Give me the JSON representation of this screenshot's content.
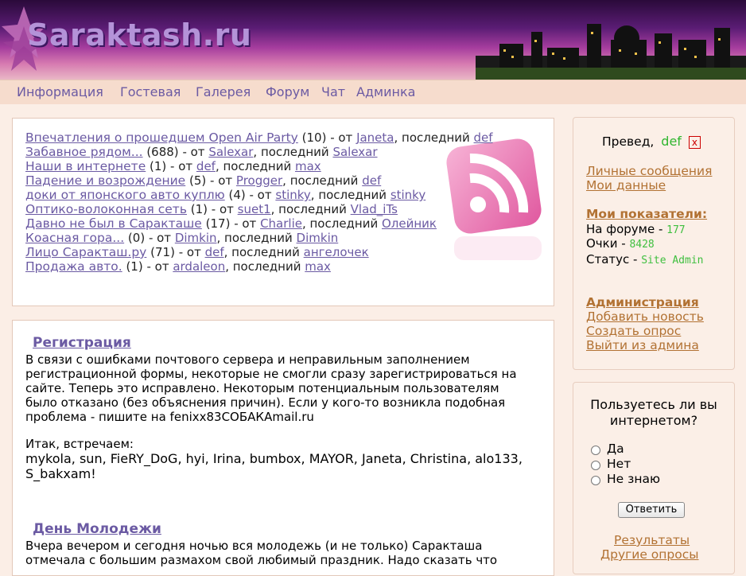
{
  "site": {
    "title": "Saraktash.ru"
  },
  "nav": [
    "Информация",
    "Гостевая",
    "Галерея",
    "Форум",
    "Чат",
    "Админка"
  ],
  "topics": [
    {
      "title": "Впечатления о прошедшем Open Air Party",
      "count": "(10)",
      "author": "Janeta",
      "last": "def"
    },
    {
      "title": "Забавное рядом...",
      "count": "(688)",
      "author": "Salexar",
      "last": "Salexar"
    },
    {
      "title": "Наши в интернете",
      "count": "(1)",
      "author": "def",
      "last": "max"
    },
    {
      "title": "Падение и возрождение",
      "count": "(5)",
      "author": "Progger",
      "last": "def"
    },
    {
      "title": "доки от японского авто куплю",
      "count": "(4)",
      "author": "stinky",
      "last": "stinky"
    },
    {
      "title": "Оптико-волоконная сеть",
      "count": "(1)",
      "author": "suet1",
      "last": "Vlad_iTs"
    },
    {
      "title": "Давно не был в Саракташе",
      "count": "(17)",
      "author": "Charlie",
      "last": "Олейник"
    },
    {
      "title": "Коасная гора...",
      "count": "(0)",
      "author": "Dimkin",
      "last": "Dimkin"
    },
    {
      "title": "Лицо Саракташ.ру",
      "count": "(71)",
      "author": "def",
      "last": "ангелочек"
    },
    {
      "title": "Продажа авто.",
      "count": "(1)",
      "author": "ardaleon",
      "last": "max"
    }
  ],
  "labels": {
    "from": " - от ",
    "last": ", последний "
  },
  "news": [
    {
      "title": "Регистрация",
      "body": "В связи с ошибками почтового сервера и неправильным заполнением регистрационной формы, некоторые не смогли сразу зарегистрироваться на сайте. Теперь это исправлено. Некоторым потенциальным пользователям было отказано (без объяснения причин). Если у кого-то возникла подобная проблема - пишите на fenixx83СОБАКАmail.ru",
      "meet_label": "Итак, встречаем:",
      "names": "mykola, sun, FieRY_DoG, hyi, Irina, bumbox, MAYOR, Janeta, Christina, alo133, S_bakxam!"
    },
    {
      "title": "День Молодежи",
      "body": "Вчера вечером и сегодня ночью вся молодежь (и не только) Саракташа отмечала с большим размахом свой любимый праздник. Надо сказать что"
    }
  ],
  "user": {
    "greeting": "Превед,",
    "name": "def",
    "logout": "x",
    "links": [
      "Личные сообщения",
      "Мои данные"
    ],
    "stats_title": "Мои показатели:",
    "forum_label": "На форуме - ",
    "forum_value": "177",
    "points_label": "Очки - ",
    "points_value": "8428",
    "status_label": "Статус - ",
    "status_value": "Site Admin",
    "admin_title": "Администрация",
    "admin_links": [
      "Добавить новость",
      "Создать опрос",
      "Выйти из админа"
    ]
  },
  "poll": {
    "question": "Пользуетесь ли вы интернетом?",
    "options": [
      "Да",
      "Нет",
      "Не знаю"
    ],
    "submit": "Ответить",
    "links": [
      "Результаты",
      "Другие опросы"
    ]
  },
  "colors": {
    "accent": "#6b5aa3",
    "sidebar_link": "#b27233",
    "green": "#3fbf3f"
  }
}
